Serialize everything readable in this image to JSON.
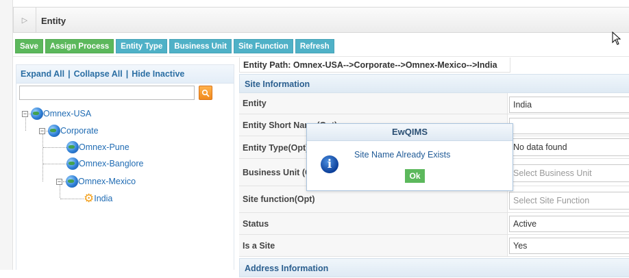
{
  "header": {
    "title": "Entity",
    "collapse_icon": "double-arrow-icon"
  },
  "toolbar": {
    "save": "Save",
    "assign_process": "Assign Process",
    "entity_type": "Entity Type",
    "business_unit": "Business Unit",
    "site_function": "Site Function",
    "refresh": "Refresh"
  },
  "tree_panel": {
    "expand_all": "Expand All",
    "collapse_all": "Collapse All",
    "hide_inactive": "Hide Inactive",
    "separator": "|",
    "search_value": "",
    "nodes": [
      {
        "label": "Omnex-USA",
        "expander": "−"
      },
      {
        "label": "Corporate",
        "expander": "−"
      },
      {
        "label": "Omnex-Pune"
      },
      {
        "label": "Omnex-Banglore"
      },
      {
        "label": "Omnex-Mexico",
        "expander": "−"
      },
      {
        "label": "India"
      }
    ]
  },
  "detail": {
    "entity_path": "Entity Path: Omnex-USA-->Corporate-->Omnex-Mexico-->India",
    "site_info_title": "Site Information",
    "address_info_title": "Address Information",
    "rows": [
      {
        "label": "Entity",
        "value": "India",
        "placeholder": false
      },
      {
        "label": "Entity Short Name(Opt)",
        "value": "",
        "placeholder": false
      },
      {
        "label": "Entity Type(Opt)",
        "value": "No data found",
        "placeholder": false
      },
      {
        "label": "Business Unit (Opt)",
        "value": "Select Business Unit",
        "placeholder": true
      },
      {
        "label": "Site function(Opt)",
        "value": "Select Site Function",
        "placeholder": true
      },
      {
        "label": "Status",
        "value": "Active",
        "placeholder": false
      },
      {
        "label": "Is a Site",
        "value": "Yes",
        "placeholder": false
      }
    ]
  },
  "dialog": {
    "title": "EwQIMS",
    "message": "Site Name Already Exists",
    "ok": "Ok",
    "icon": "info-icon"
  },
  "colors": {
    "green": "#5cb85c",
    "blue": "#4fb1c7",
    "link": "#1f6bb3",
    "search": "#f08a1c"
  }
}
